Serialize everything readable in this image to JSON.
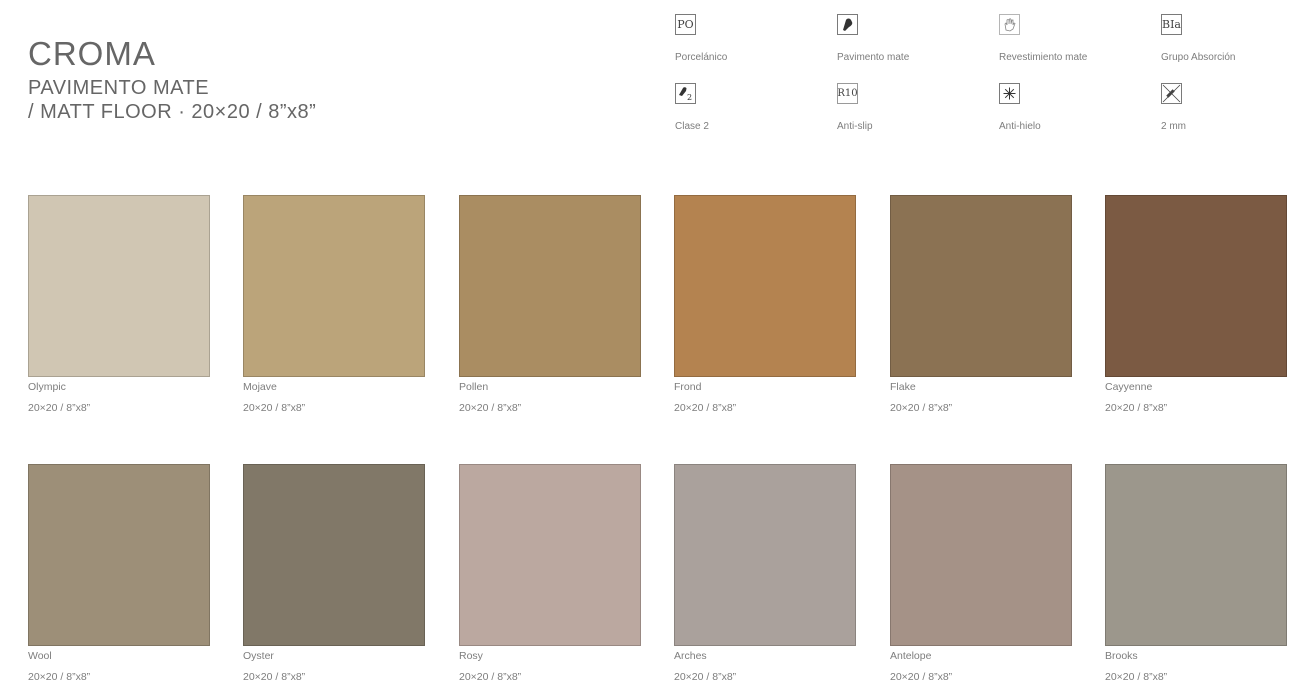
{
  "header": {
    "title": "CROMA",
    "subtitle_line1": "PAVIMENTO MATE",
    "subtitle_line2": "/ MATT FLOOR · 20×20 / 8”x8”"
  },
  "features": [
    {
      "icon": "porcelain-icon",
      "icon_text": "PO",
      "label": "Porcelánico"
    },
    {
      "icon": "shoe-icon",
      "icon_text": "",
      "label": "Pavimento mate"
    },
    {
      "icon": "hand-icon",
      "icon_text": "",
      "label": "Revestimiento mate"
    },
    {
      "icon": "absorption-icon",
      "icon_text": "BIa",
      "label": "Grupo Absorción"
    },
    {
      "icon": "class-2-icon",
      "icon_text": "2",
      "label": "Clase 2"
    },
    {
      "icon": "anti-slip-icon",
      "icon_text": "R10",
      "label": "Anti-slip"
    },
    {
      "icon": "snowflake-icon",
      "icon_text": "",
      "label": "Anti-hielo"
    },
    {
      "icon": "thickness-icon",
      "icon_text": "",
      "label": "2 mm"
    }
  ],
  "tiles": [
    {
      "name": "Olympic",
      "size": "20×20 / 8”x8”",
      "color": "#d0c6b3"
    },
    {
      "name": "Mojave",
      "size": "20×20 / 8”x8”",
      "color": "#bba47a"
    },
    {
      "name": "Pollen",
      "size": "20×20 / 8”x8”",
      "color": "#aa8d62"
    },
    {
      "name": "Frond",
      "size": "20×20 / 8”x8”",
      "color": "#b48350"
    },
    {
      "name": "Flake",
      "size": "20×20 / 8”x8”",
      "color": "#8b7253"
    },
    {
      "name": "Cayyenne",
      "size": "20×20 / 8”x8”",
      "color": "#7b5a43"
    },
    {
      "name": "Wool",
      "size": "20×20 / 8”x8”",
      "color": "#9d8f78"
    },
    {
      "name": "Oyster",
      "size": "20×20 / 8”x8”",
      "color": "#817868"
    },
    {
      "name": "Rosy",
      "size": "20×20 / 8”x8”",
      "color": "#bba8a0"
    },
    {
      "name": "Arches",
      "size": "20×20 / 8”x8”",
      "color": "#aaa19c"
    },
    {
      "name": "Antelope",
      "size": "20×20 / 8”x8”",
      "color": "#a59287"
    },
    {
      "name": "Brooks",
      "size": "20×20 / 8”x8”",
      "color": "#9c978c"
    }
  ]
}
